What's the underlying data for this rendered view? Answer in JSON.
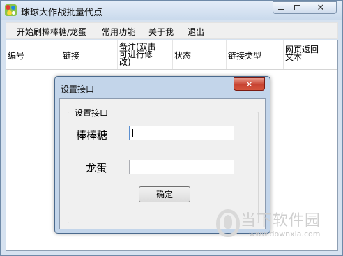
{
  "window": {
    "title": "球球大作战批量代点",
    "icon": "game-app-icon"
  },
  "menu": {
    "items": [
      {
        "label": "开始刷棒棒糖/龙蛋"
      },
      {
        "label": "常用功能"
      },
      {
        "label": "关于我"
      },
      {
        "label": "退出"
      }
    ]
  },
  "table": {
    "columns": [
      {
        "label": "编号"
      },
      {
        "label": "链接"
      },
      {
        "label": "备注(双击可进行修改)"
      },
      {
        "label": "状态"
      },
      {
        "label": "链接类型"
      },
      {
        "label": "网页返回文本"
      }
    ],
    "rows": []
  },
  "dialog": {
    "title": "设置接口",
    "group_label": "设置接口",
    "field1_label": "棒棒糖",
    "field1_value": "",
    "field2_label": "龙蛋",
    "field2_value": "",
    "ok_label": "确定",
    "close_icon": "close-icon"
  },
  "watermark": {
    "text": "当下软件园",
    "url": "www.downxia.com"
  },
  "colors": {
    "titlebar": "#c9d9ec",
    "dialog_close": "#c74331",
    "dialog_frame": "#c3d5ea"
  }
}
